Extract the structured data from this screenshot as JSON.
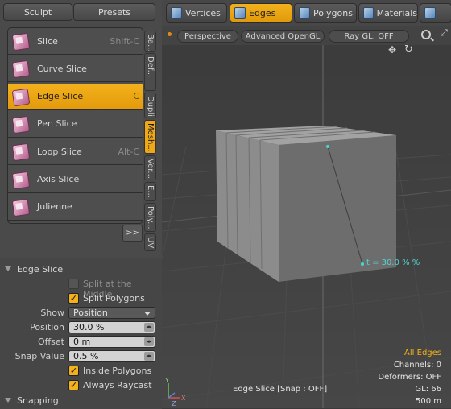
{
  "top_buttons": {
    "sculpt": "Sculpt",
    "presets": "Presets"
  },
  "tools": [
    {
      "label": "Slice",
      "shortcut": "Shift-C",
      "active": false,
      "icon": "slice-icon"
    },
    {
      "label": "Curve Slice",
      "shortcut": "",
      "active": false,
      "icon": "curve-slice-icon"
    },
    {
      "label": "Edge Slice",
      "shortcut": "C",
      "active": true,
      "icon": "edge-slice-icon"
    },
    {
      "label": "Pen Slice",
      "shortcut": "",
      "active": false,
      "icon": "pen-slice-icon"
    },
    {
      "label": "Loop Slice",
      "shortcut": "Alt-C",
      "active": false,
      "icon": "loop-slice-icon"
    },
    {
      "label": "Axis Slice",
      "shortcut": "",
      "active": false,
      "icon": "axis-slice-icon"
    },
    {
      "label": "Julienne",
      "shortcut": "",
      "active": false,
      "icon": "julienne-icon"
    }
  ],
  "more_button": ">>",
  "side_tabs": [
    "Ba...",
    "Def...",
    "Dupli...",
    "Mesh...",
    "Ver...",
    "E...",
    "Poly...",
    "UV"
  ],
  "properties": {
    "section_title": "Edge Slice",
    "split_middle": "Split at the Middle",
    "split_polygons": "Split Polygons",
    "show_label": "Show",
    "show_value": "Position",
    "position_label": "Position",
    "position_value": "30.0 %",
    "offset_label": "Offset",
    "offset_value": "0 m",
    "snap_label": "Snap Value",
    "snap_value": "0.5 %",
    "inside_polygons": "Inside Polygons",
    "always_raycast": "Always Raycast",
    "snapping_title": "Snapping"
  },
  "mode_tabs": [
    {
      "label": "Vertices",
      "active": false
    },
    {
      "label": "Edges",
      "active": true
    },
    {
      "label": "Polygons",
      "active": false
    },
    {
      "label": "Materials",
      "active": false
    },
    {
      "label": "",
      "active": false
    }
  ],
  "viewport": {
    "view_label": "Perspective",
    "shading_label": "Advanced OpenGL",
    "raygl_label": "Ray GL: OFF",
    "tool_readout": "t = 30.0 % %",
    "status": "Edge Slice  [Snap : OFF]",
    "hud_all_edges": "All Edges",
    "hud_channels": "Channels: 0",
    "hud_deformers": "Deformers: OFF",
    "hud_gl": "GL: 66",
    "hud_scale": "500 m"
  },
  "colors": {
    "accent": "#f0a817",
    "highlight_edge": "#4fd4d0",
    "panel": "#4a4a4a"
  }
}
